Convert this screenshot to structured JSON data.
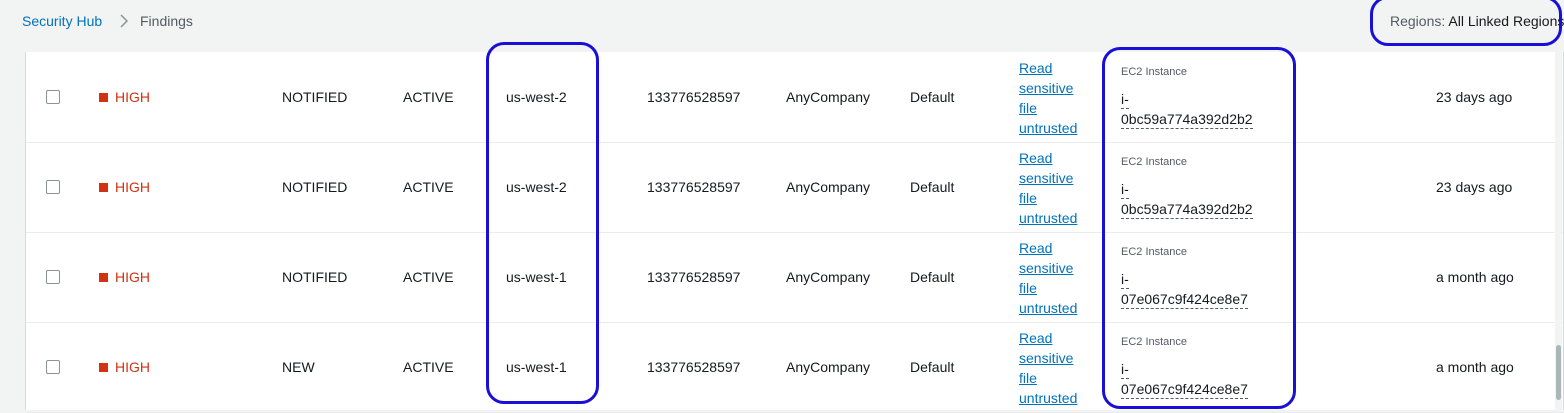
{
  "breadcrumb": {
    "root": "Security Hub",
    "current": "Findings"
  },
  "regions": {
    "label": "Regions:",
    "value": "All Linked Regions"
  },
  "colors": {
    "severity_high": "#d13212",
    "link": "#0073bb",
    "highlight": "#1a0fd6"
  },
  "icons": {
    "breadcrumb_separator": "chevron-right-icon",
    "severity": "severity-square-icon"
  },
  "findings": [
    {
      "severity": "HIGH",
      "workflow_status": "NOTIFIED",
      "record_state": "ACTIVE",
      "region": "us-west-2",
      "account_id": "133776528597",
      "company": "AnyCompany",
      "product": "Default",
      "title_lines": [
        "Read",
        "sensitive",
        "file",
        "untrusted"
      ],
      "resource_type": "EC2 Instance",
      "resource_id_lines": [
        "i-",
        "0bc59a774a392d2b2"
      ],
      "updated": "23 days ago"
    },
    {
      "severity": "HIGH",
      "workflow_status": "NOTIFIED",
      "record_state": "ACTIVE",
      "region": "us-west-2",
      "account_id": "133776528597",
      "company": "AnyCompany",
      "product": "Default",
      "title_lines": [
        "Read",
        "sensitive",
        "file",
        "untrusted"
      ],
      "resource_type": "EC2 Instance",
      "resource_id_lines": [
        "i-",
        "0bc59a774a392d2b2"
      ],
      "updated": "23 days ago"
    },
    {
      "severity": "HIGH",
      "workflow_status": "NOTIFIED",
      "record_state": "ACTIVE",
      "region": "us-west-1",
      "account_id": "133776528597",
      "company": "AnyCompany",
      "product": "Default",
      "title_lines": [
        "Read",
        "sensitive",
        "file",
        "untrusted"
      ],
      "resource_type": "EC2 Instance",
      "resource_id_lines": [
        "i-",
        "07e067c9f424ce8e7"
      ],
      "updated": "a month ago"
    },
    {
      "severity": "HIGH",
      "workflow_status": "NEW",
      "record_state": "ACTIVE",
      "region": "us-west-1",
      "account_id": "133776528597",
      "company": "AnyCompany",
      "product": "Default",
      "title_lines": [
        "Read",
        "sensitive",
        "file",
        "untrusted"
      ],
      "resource_type": "EC2 Instance",
      "resource_id_lines": [
        "i-",
        "07e067c9f424ce8e7"
      ],
      "updated": "a month ago"
    }
  ]
}
